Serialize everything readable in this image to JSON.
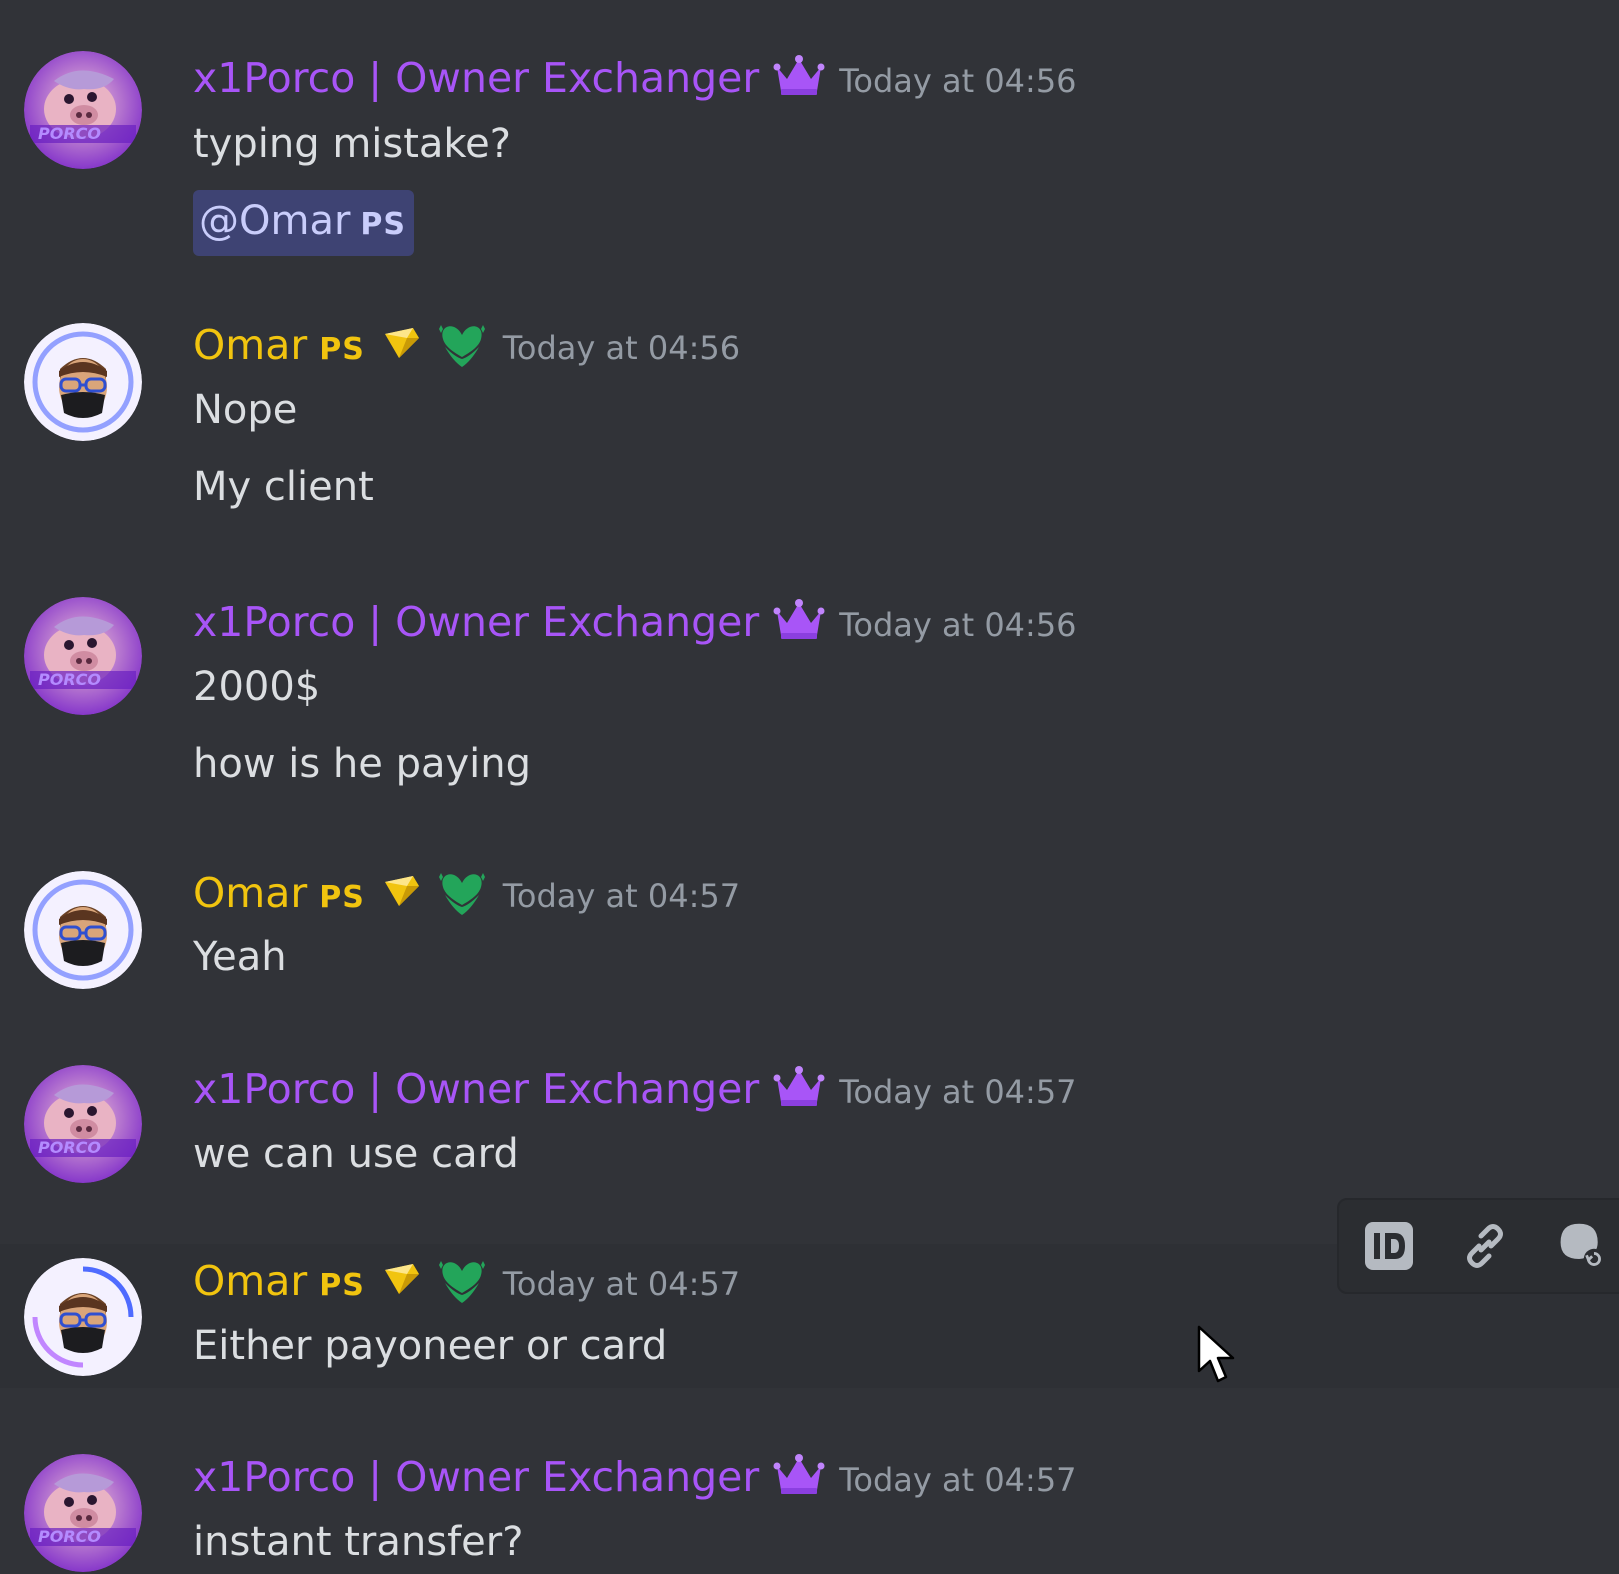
{
  "messages": [
    {
      "author": "x1Porco | Owner Exchanger",
      "timestamp": "Today at 04:56",
      "lines": [
        "typing mistake?"
      ],
      "mention": {
        "name": "@Omar",
        "tag": "PS"
      }
    },
    {
      "author": "Omar",
      "tag": "PS",
      "timestamp": "Today at 04:56",
      "lines": [
        "Nope",
        "My client"
      ]
    },
    {
      "author": "x1Porco | Owner Exchanger",
      "timestamp": "Today at 04:56",
      "lines": [
        "2000$",
        "how is he paying"
      ]
    },
    {
      "author": "Omar",
      "tag": "PS",
      "timestamp": "Today at 04:57",
      "lines": [
        "Yeah"
      ]
    },
    {
      "author": "x1Porco | Owner Exchanger",
      "timestamp": "Today at 04:57",
      "lines": [
        "we can use card"
      ]
    },
    {
      "author": "Omar",
      "tag": "PS",
      "timestamp": "Today at 04:57",
      "lines": [
        "Either payoneer or card"
      ]
    },
    {
      "author": "x1Porco | Owner Exchanger",
      "timestamp": "Today at 04:57",
      "lines": [
        "instant transfer?"
      ]
    }
  ],
  "toolbar": {
    "buttons": [
      "id-icon",
      "link-icon",
      "reply-thread-icon"
    ]
  },
  "colors": {
    "background": "#313338",
    "porco_name": "#a855f7",
    "omar_name": "#f1c40f",
    "timestamp": "#949ba4",
    "text": "#dbdee1",
    "mention_bg": "#3e4373"
  }
}
